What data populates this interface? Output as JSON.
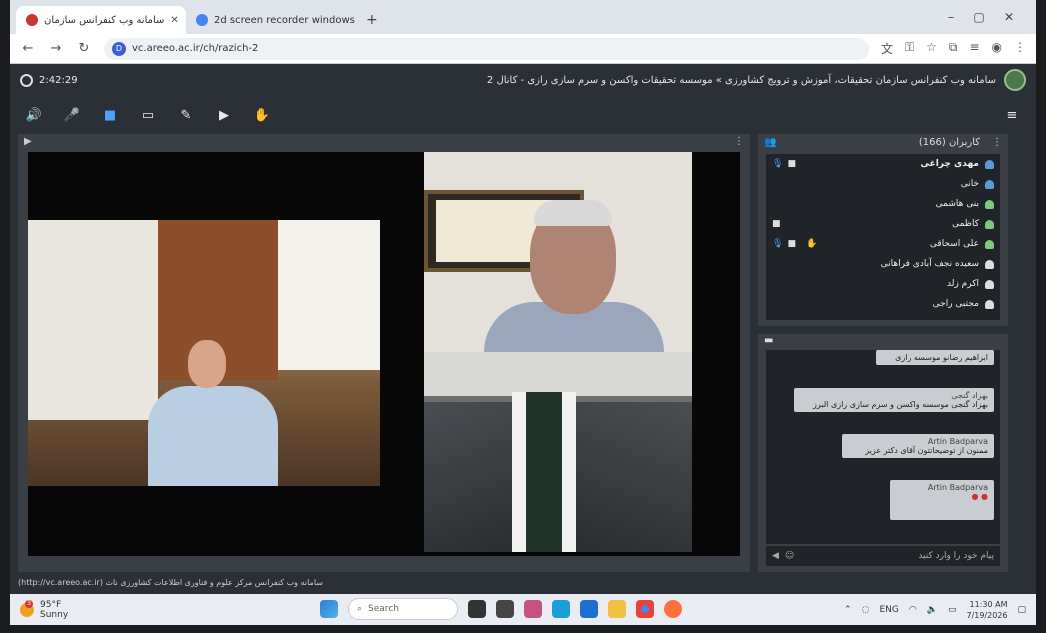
{
  "browser": {
    "tabs": [
      {
        "title": "سامانه وب کنفرانس سازمان",
        "active": true
      },
      {
        "title": "2d screen recorder windows 1",
        "active": false
      }
    ],
    "new_tab": "+",
    "url": "vc.areeo.ac.ir/ch/razich-2",
    "window_controls": {
      "minimize": "–",
      "maximize": "▢",
      "close": "✕"
    }
  },
  "app": {
    "clock": "2:42:29",
    "title": "سامانه وب کنفرانس سازمان تحقیقات، آموزش و ترویج کشاورزی » موسسه تحقیقات واکسن و سرم سازی رازی - کانال 2",
    "footer": "(http://vc.areeo.ac.ir) سامانه وب کنفرانس مرکز علوم و فناوری اطلاعات کشاورزی ناث",
    "toolbar_icons": [
      "speaker-icon",
      "microphone-icon",
      "camera-icon",
      "screen-share-icon",
      "brush-icon",
      "play-icon",
      "raise-hand-icon"
    ]
  },
  "participants": {
    "title": "کاربران (166)",
    "users": [
      {
        "name": "مهدی چراغی",
        "bold": true,
        "mic": true,
        "cam": true,
        "hand": false,
        "color": "#5b9bd5"
      },
      {
        "name": "خانی",
        "bold": false,
        "mic": false,
        "cam": false,
        "hand": false,
        "color": "#5b9bd5"
      },
      {
        "name": "بنی هاشمی",
        "bold": false,
        "mic": false,
        "cam": false,
        "hand": false,
        "color": "#7ec87e"
      },
      {
        "name": "کاظمی",
        "bold": false,
        "mic": false,
        "cam": true,
        "hand": false,
        "color": "#7ec87e"
      },
      {
        "name": "علی اسحاقی",
        "bold": false,
        "mic": true,
        "cam": true,
        "hand": true,
        "color": "#7ec87e"
      },
      {
        "name": "سعیده نجف آبادی فراهانی",
        "bold": false,
        "mic": false,
        "cam": false,
        "hand": false,
        "color": "#dddddd"
      },
      {
        "name": "اکرم زلد",
        "bold": false,
        "mic": false,
        "cam": false,
        "hand": false,
        "color": "#dddddd"
      },
      {
        "name": "مجتبی راجی",
        "bold": false,
        "mic": false,
        "cam": false,
        "hand": false,
        "color": "#dddddd"
      }
    ]
  },
  "chat": {
    "messages": [
      {
        "author": "",
        "text": "ابراهیم رضانو موسسه رازی"
      },
      {
        "author": "بهزاد گنجی",
        "text": "بهزاد گنجی موسسه واکسن و سرم سازی رازی البرز"
      },
      {
        "author": "Artin Badparva",
        "text": "ممنون از توضیحاتتون آقای دکتر عزیز"
      },
      {
        "author": "Artin Badparva",
        "text": ""
      }
    ],
    "placeholder": "پیام خود را وارد کنید"
  },
  "taskbar": {
    "weather_temp": "95°F",
    "weather_desc": "Sunny",
    "weather_badge": "3",
    "search_placeholder": "Search",
    "lang": "ENG",
    "time": "11:30 AM",
    "date": "7/19/2026"
  }
}
